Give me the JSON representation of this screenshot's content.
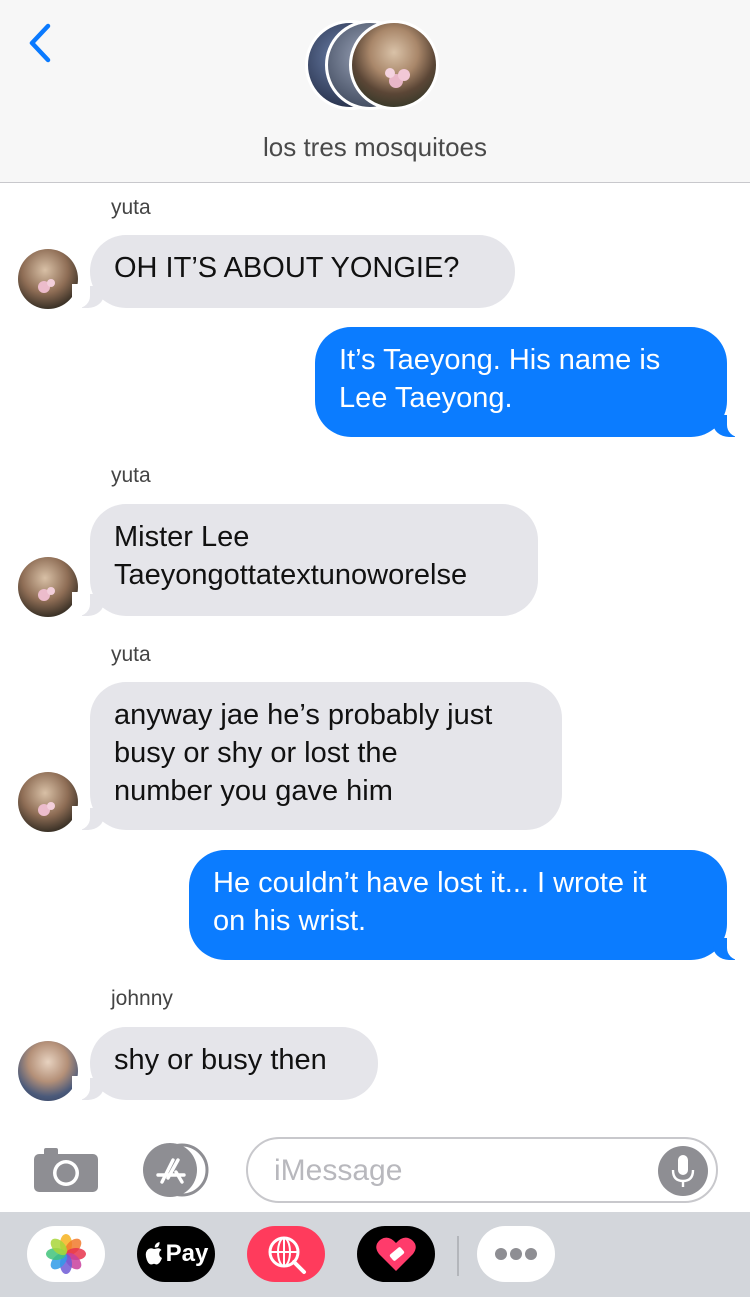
{
  "header": {
    "title": "los tres mosquitoes"
  },
  "messages": [
    {
      "sender": "yuta",
      "text": "OH IT’S ABOUT YONGIE?"
    },
    {
      "text": "It’s Taeyong. His name is\nLee Taeyong."
    },
    {
      "sender": "yuta",
      "text": "Mister Lee\nTaeyongottatextunoworelse"
    },
    {
      "sender": "yuta",
      "text": "anyway jae he’s probably just\nbusy or shy or lost the\nnumber you gave him"
    },
    {
      "text": "He couldn’t have lost it... I wrote it\non his wrist."
    },
    {
      "sender": "johnny",
      "text": "shy or busy then"
    }
  ],
  "composer": {
    "placeholder": "iMessage"
  },
  "tray": {
    "apple_pay_label": "Pay"
  },
  "colors": {
    "incoming_bubble": "#e5e5ea",
    "outgoing_bubble": "#0b7cff",
    "accent": "#0a7aff"
  }
}
